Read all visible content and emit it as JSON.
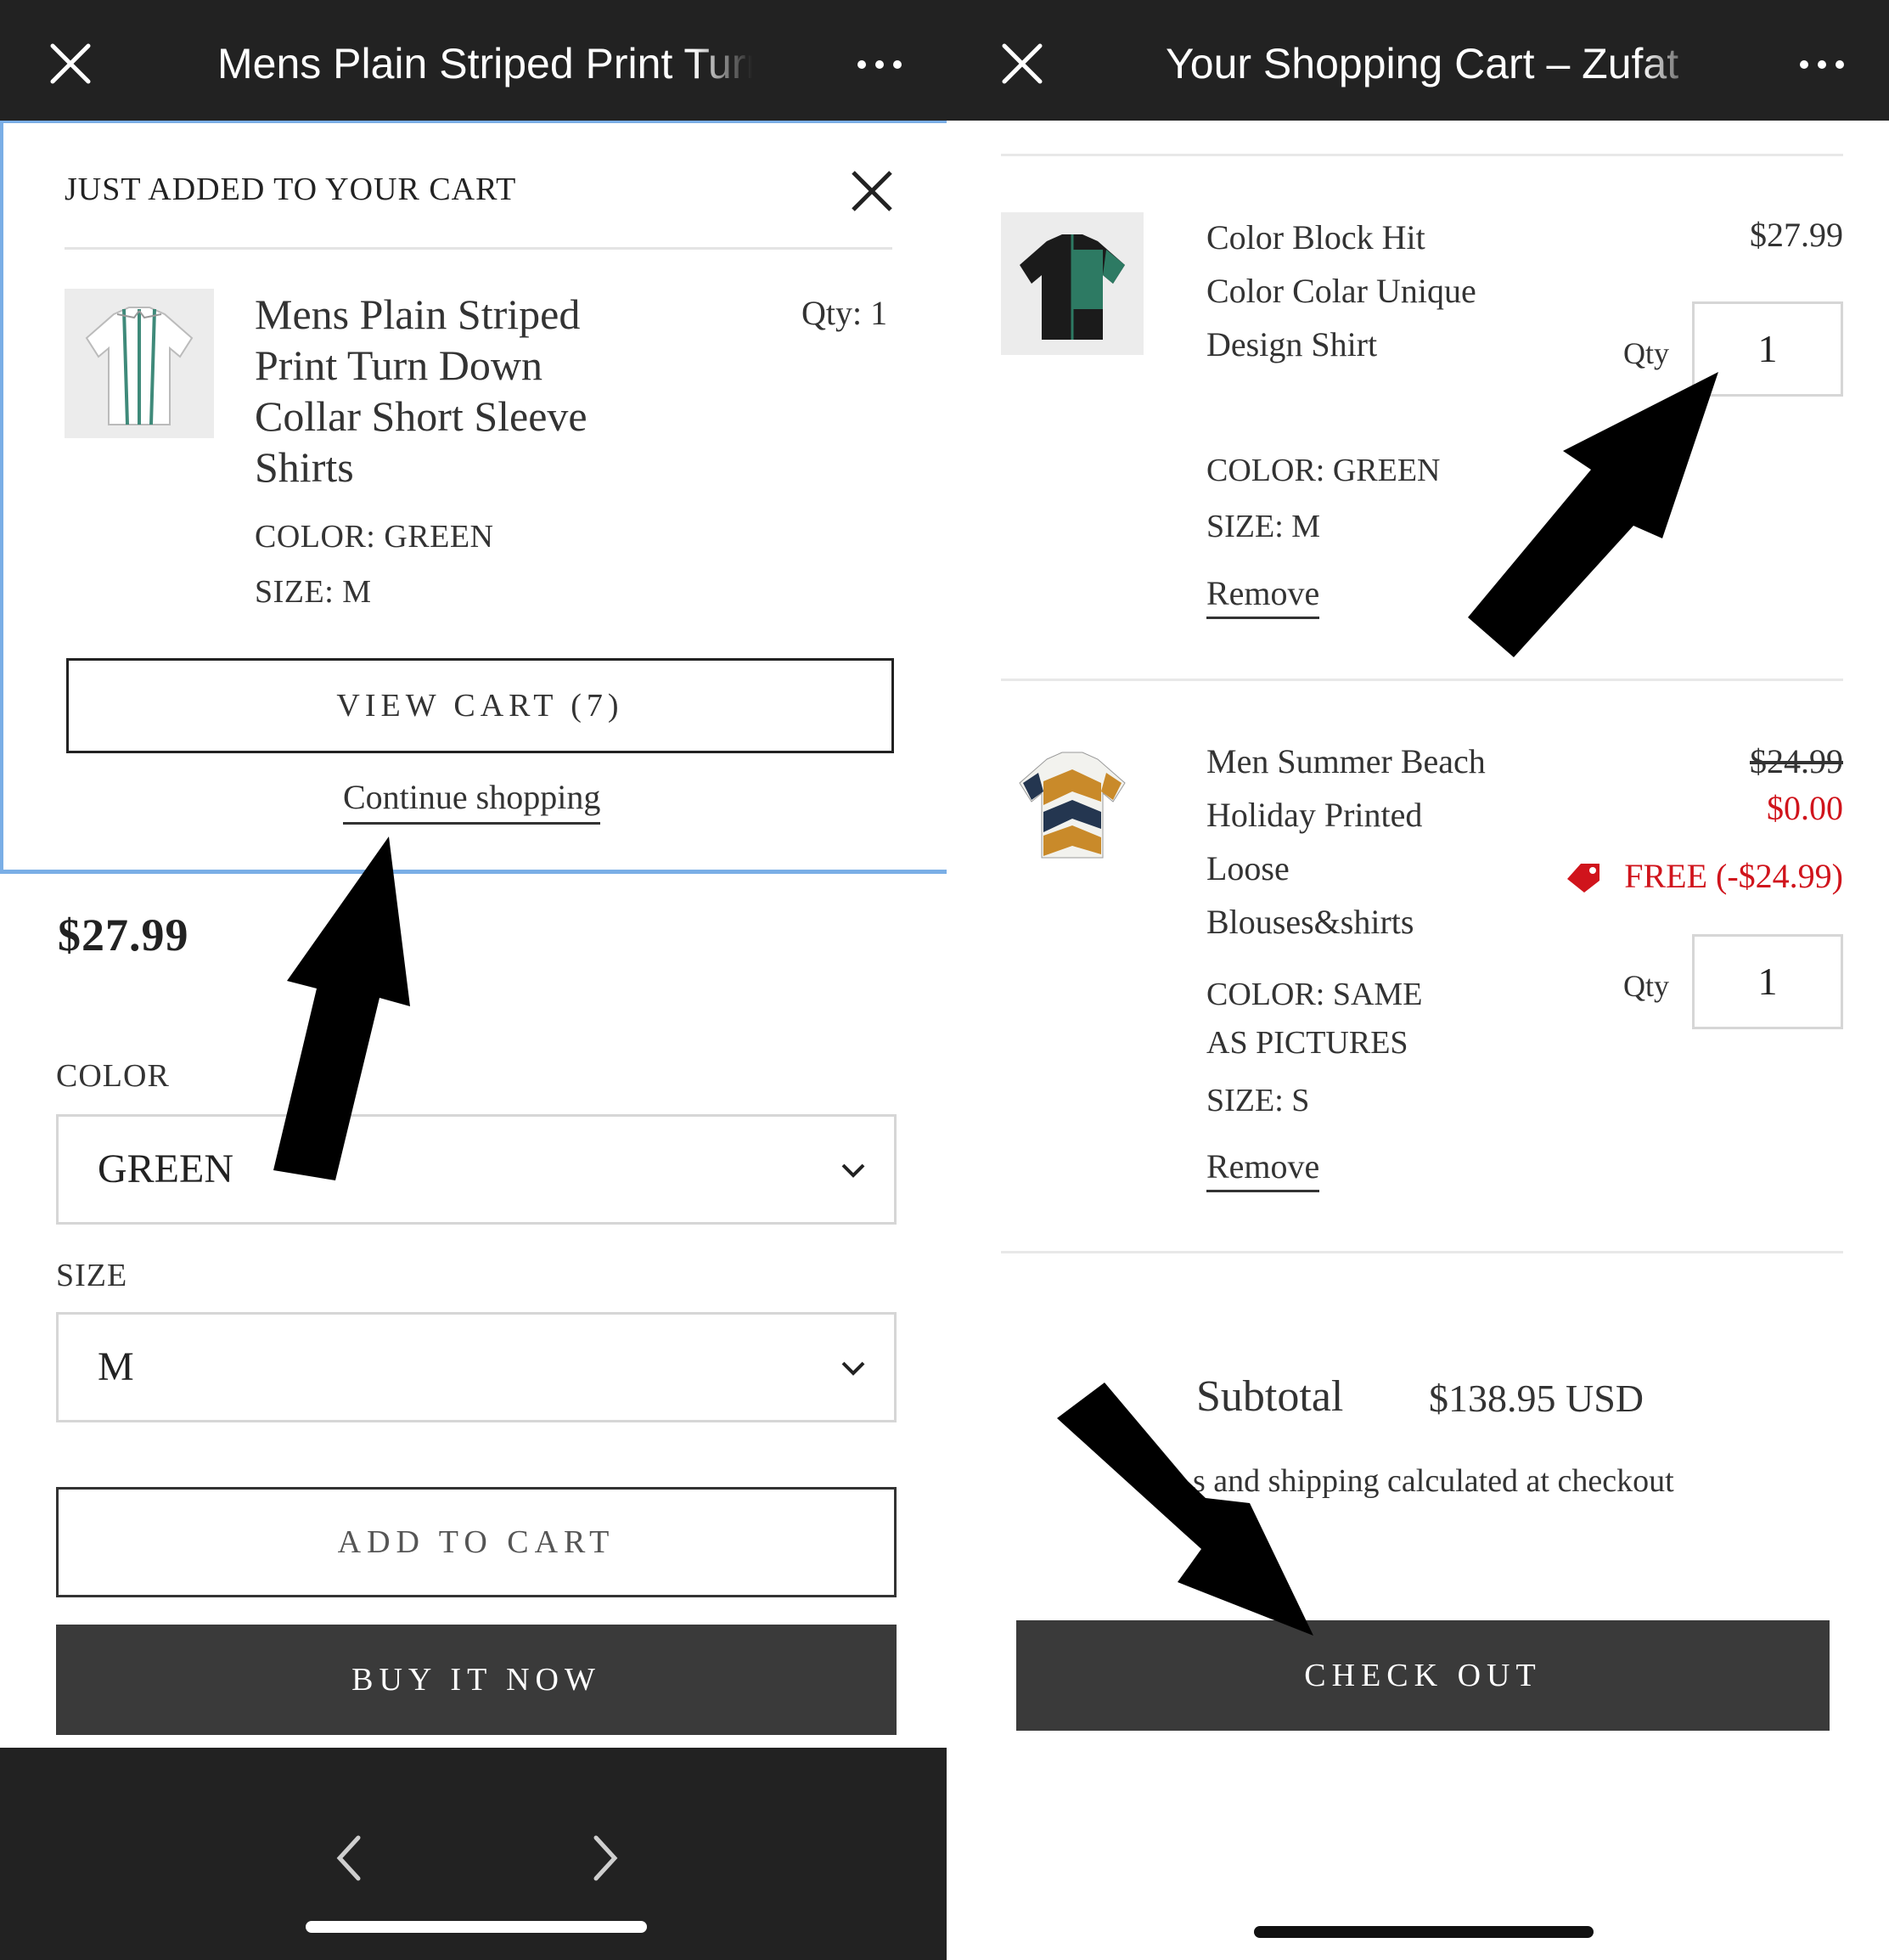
{
  "colors": {
    "top_bar": "#222222",
    "popup_border": "#7aaee6",
    "dark_button": "#3a3a3a",
    "sale_red": "#d0141c",
    "text": "#333333"
  },
  "left": {
    "title": "Mens Plain Striped Print Turn Down Collar Short Sleeve Shirts",
    "popup": {
      "heading": "JUST ADDED TO YOUR CART",
      "product": {
        "name": "Mens Plain Striped Print Turn Down Collar Short Sleeve Shirts",
        "qty": "Qty: 1",
        "color": "COLOR: GREEN",
        "size": "SIZE: M"
      },
      "view_cart": "VIEW CART (7)",
      "continue": "Continue shopping"
    },
    "price": "$27.99",
    "color_label": "COLOR",
    "color_value": "GREEN",
    "size_label": "SIZE",
    "size_value": "M",
    "add_to_cart": "ADD TO CART",
    "buy_now": "BUY IT NOW"
  },
  "right": {
    "title": "Your Shopping Cart – Zufat",
    "items": [
      {
        "name": "Color Block Hit Color Colar Unique Design Shirt",
        "price": "$27.99",
        "qty_label": "Qty",
        "qty": "1",
        "color": "COLOR: GREEN",
        "size": "SIZE: M",
        "remove": "Remove"
      },
      {
        "name": "Men Summer Beach Holiday Printed Loose Blouses&shirts",
        "original_price": "$24.99",
        "sale_price": "$0.00",
        "discount": "FREE (-$24.99)",
        "qty_label": "Qty",
        "qty": "1",
        "color": "COLOR: SAME AS PICTURES",
        "size": "SIZE: S",
        "remove": "Remove"
      }
    ],
    "subtotal_label": "Subtotal",
    "subtotal_value": "$138.95 USD",
    "shipping_note": "s and shipping calculated at checkout",
    "checkout": "CHECK OUT"
  },
  "icons": {
    "close": "close-icon",
    "more": "more-dots-icon",
    "chevron": "chevron-down-icon",
    "back": "chevron-left-icon",
    "forward": "chevron-right-icon",
    "tag": "price-tag-icon"
  }
}
